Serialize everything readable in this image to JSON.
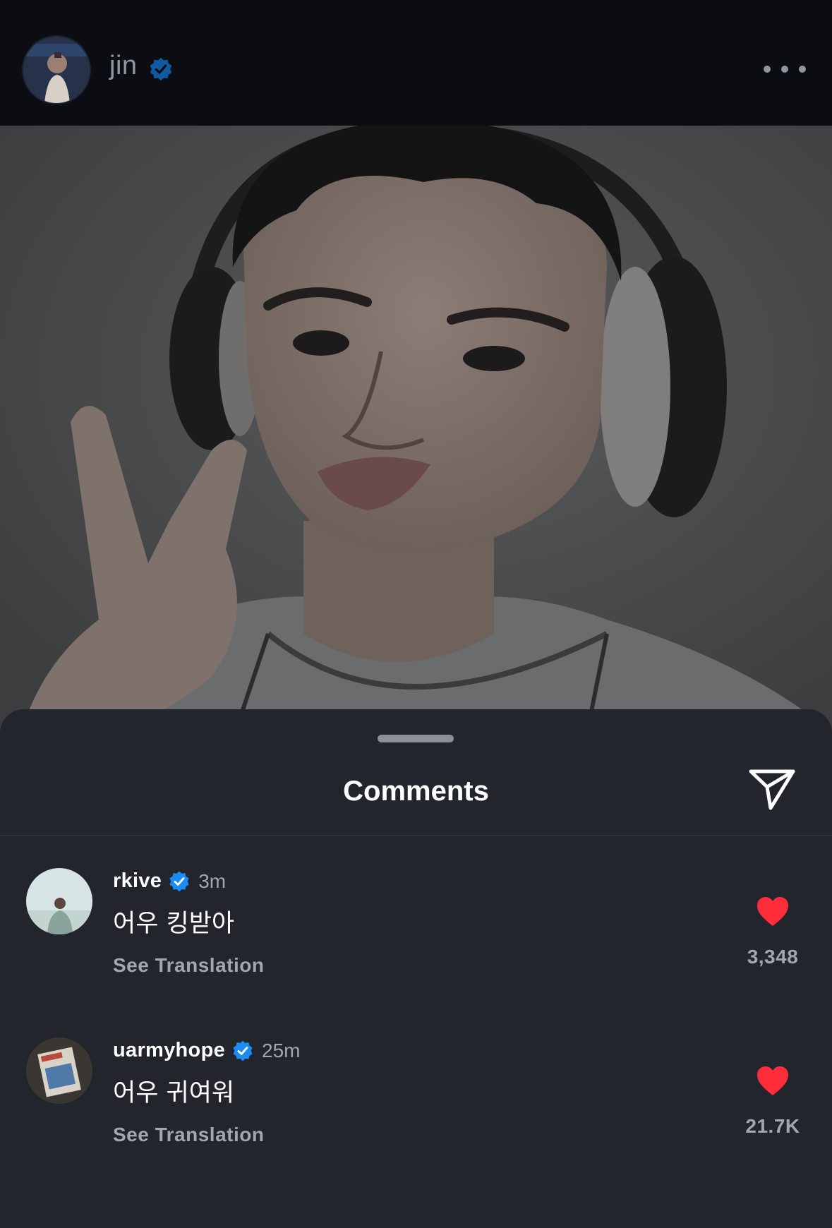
{
  "post": {
    "username": "jin",
    "verified": true
  },
  "comments_sheet": {
    "title": "Comments",
    "comments": [
      {
        "username": "rkive",
        "verified": true,
        "time": "3m",
        "text": "어우 킹받아",
        "translate_label": "See Translation",
        "like_count": "3,348",
        "liked": true
      },
      {
        "username": "uarmyhope",
        "verified": true,
        "time": "25m",
        "text": "어우 귀여워",
        "translate_label": "See Translation",
        "like_count": "21.7K",
        "liked": true
      }
    ]
  },
  "icons": {
    "more": "more-horizontal-icon",
    "share": "paper-plane-icon",
    "like": "heart-filled-icon",
    "verified": "verified-badge-icon"
  },
  "colors": {
    "sheet_background": "#22252b",
    "verified_blue": "#1c8cf5",
    "heart_red": "#ff2d3a",
    "muted_text": "#a2a6ad"
  }
}
